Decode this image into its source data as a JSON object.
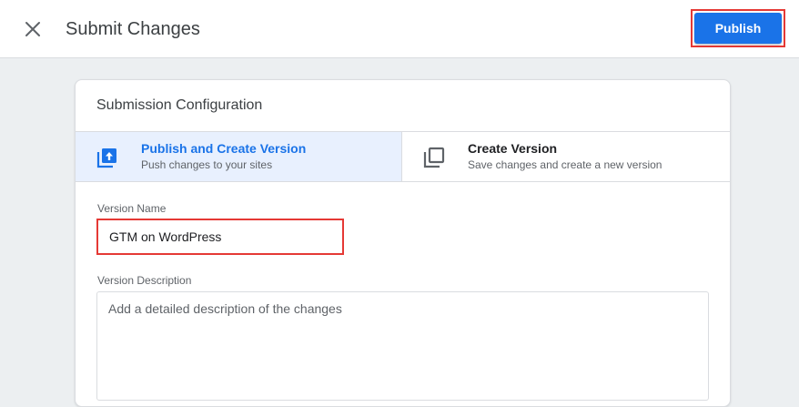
{
  "header": {
    "title": "Submit Changes",
    "close_icon": "close-icon",
    "publish_label": "Publish"
  },
  "config": {
    "title": "Submission Configuration",
    "options": [
      {
        "name": "Publish and Create Version",
        "description": "Push changes to your sites",
        "icon": "publish-upload-icon",
        "selected": true
      },
      {
        "name": "Create Version",
        "description": "Save changes and create a new version",
        "icon": "version-copy-icon",
        "selected": false
      }
    ],
    "version_name_label": "Version Name",
    "version_name_value": "GTM on WordPress",
    "version_description_label": "Version Description",
    "version_description_placeholder": "Add a detailed description of the changes"
  },
  "colors": {
    "accent": "#1a73e8",
    "highlight_outline": "#e53935",
    "selected_bg": "#e8f0fe",
    "page_bg": "#eceff1"
  }
}
